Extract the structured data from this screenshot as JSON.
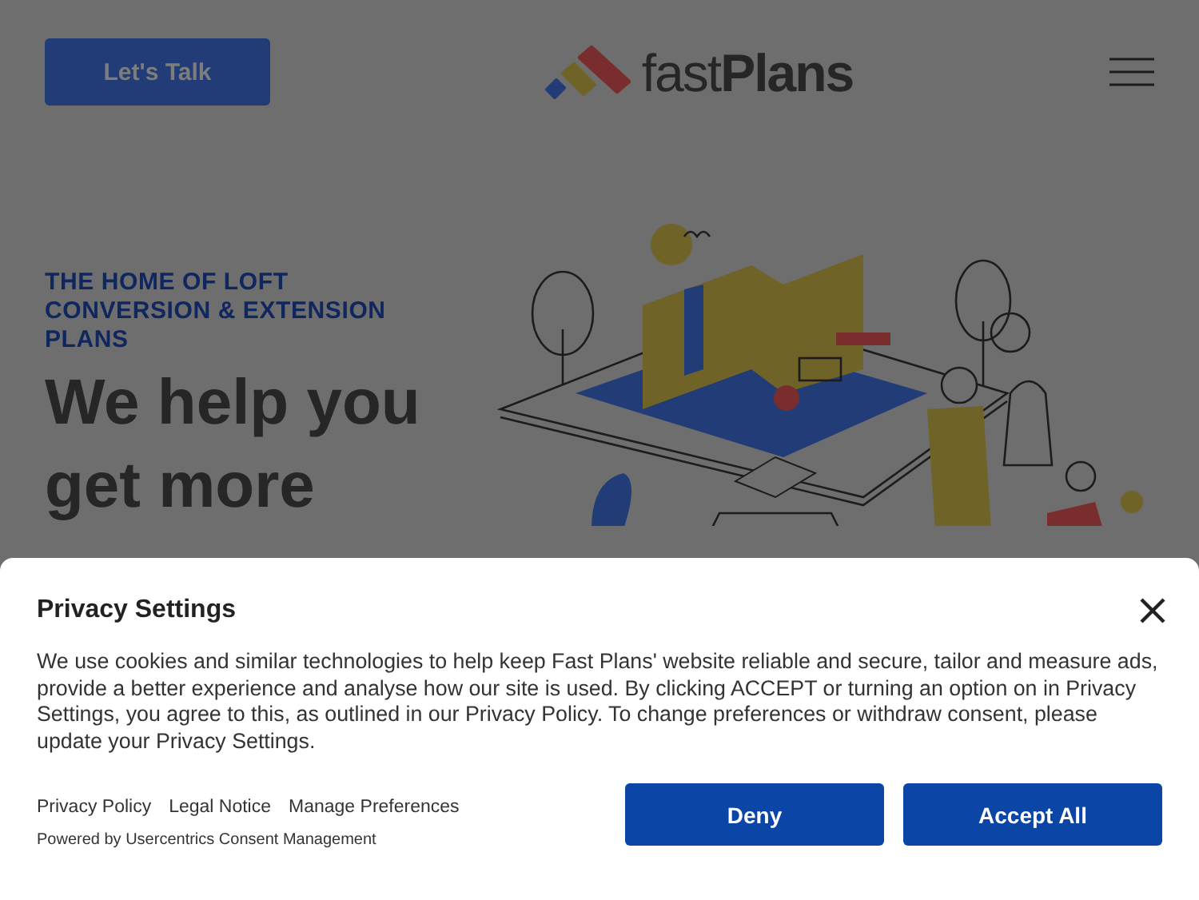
{
  "header": {
    "cta_button": "Let's Talk",
    "logo_text": "fast**Plans**"
  },
  "hero": {
    "eyebrow": "THE HOME OF LOFT CONVERSION & EXTENSION PLANS",
    "heading": "We help you get more"
  },
  "consent": {
    "title": "Privacy Settings",
    "body": "We use cookies and similar technologies to help keep Fast Plans' website reliable and secure, tailor and measure ads, provide a better experience and analyse how our site is used. By clicking ACCEPT or turning an option on in Privacy Settings, you agree to this, as outlined in our Privacy Policy. To change preferences or withdraw consent, please update your Privacy Settings.",
    "links": [
      "Privacy Policy",
      "Legal Notice",
      "Manage Preferences"
    ],
    "powered_by": "Powered by Usercentrics Consent Management",
    "buttons": [
      "Deny",
      "Accept All"
    ]
  }
}
